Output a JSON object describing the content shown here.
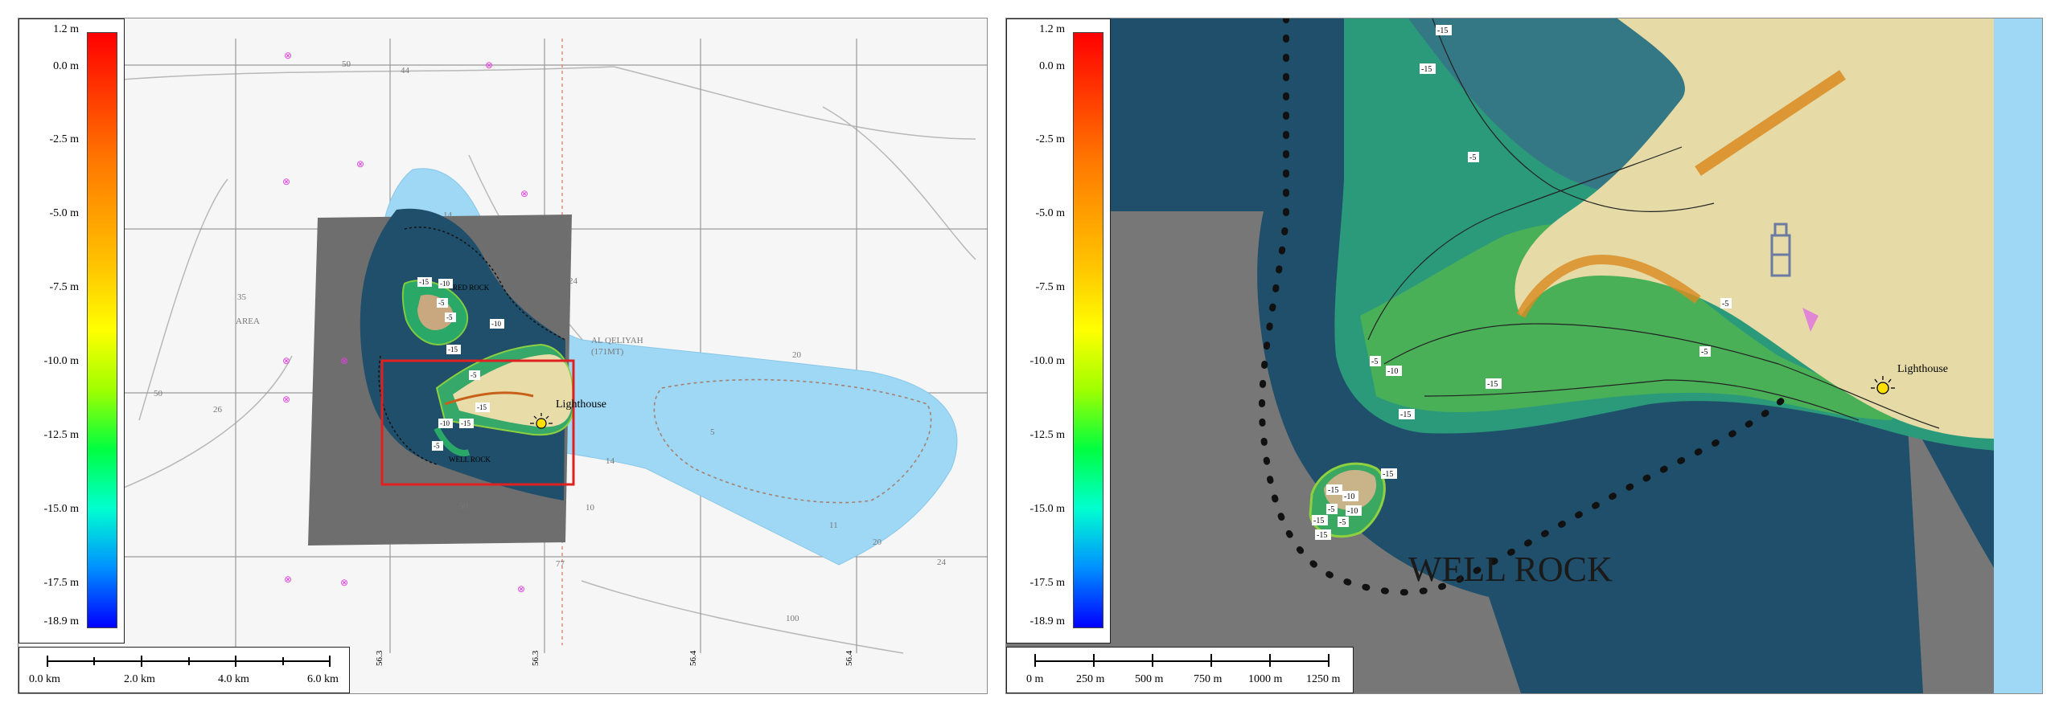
{
  "left_panel": {
    "colorbar": {
      "labels": [
        "1.2 m",
        "0.0 m",
        "-2.5 m",
        "-5.0 m",
        "-7.5 m",
        "-10.0 m",
        "-12.5 m",
        "-15.0 m",
        "-17.5 m",
        "-18.9 m"
      ]
    },
    "scalebar": {
      "labels": [
        "0.0 km",
        "2.0 km",
        "4.0 km",
        "6.0 km"
      ]
    },
    "map_labels": {
      "lighthouse": "Lighthouse",
      "red_rock": "RED ROCK",
      "well_rock": "WELL ROCK",
      "area": "AREA",
      "al_qeliyah": "AL QELIYAH",
      "al_qeliyah_sub": "(171MT)"
    },
    "grid_labels": [
      "56.3",
      "56.3",
      "56.4",
      "56.4"
    ],
    "soundings": [
      "50",
      "44",
      "35",
      "26",
      "50",
      "24",
      "14",
      "20",
      "10",
      "5",
      "11",
      "20",
      "24",
      "100",
      "77",
      "50",
      "14"
    ],
    "contour_labels": [
      "-15",
      "-10",
      "-5",
      "-5",
      "-10",
      "-15",
      "-5",
      "-10",
      "-15",
      "-15",
      "-5"
    ]
  },
  "right_panel": {
    "colorbar": {
      "labels": [
        "1.2 m",
        "0.0 m",
        "-2.5 m",
        "-5.0 m",
        "-7.5 m",
        "-10.0 m",
        "-12.5 m",
        "-15.0 m",
        "-17.5 m",
        "-18.9 m"
      ]
    },
    "scalebar": {
      "labels": [
        "0 m",
        "250 m",
        "500 m",
        "750 m",
        "1000 m",
        "1250 m"
      ]
    },
    "map_labels": {
      "lighthouse": "Lighthouse",
      "well_rock": "WELL ROCK"
    },
    "contour_labels": [
      "-15",
      "-15",
      "-5",
      "-5",
      "-10",
      "-5",
      "-15",
      "-15",
      "-5",
      "-15",
      "-15",
      "-10",
      "-10",
      "-5",
      "-15",
      "-5",
      "-15"
    ]
  },
  "colors": {
    "shallow_highlight": "#9fd8f5",
    "deep_water": "#1f4f6a",
    "land": "#e8dca8",
    "grey_area": "#707070",
    "selection_box": "#e02020"
  }
}
